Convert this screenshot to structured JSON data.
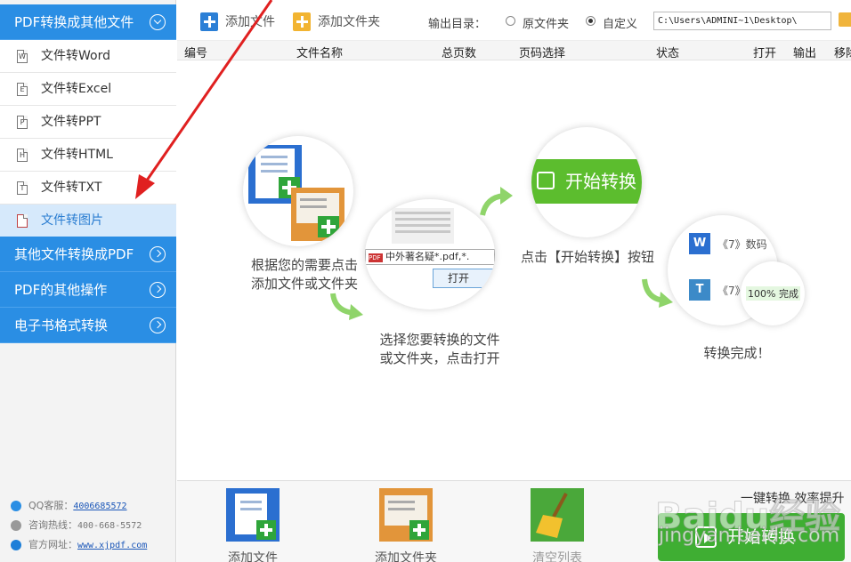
{
  "sidebar": {
    "sections": [
      {
        "label": "PDF转换成其他文件",
        "expanded": true
      },
      {
        "label": "其他文件转换成PDF",
        "expanded": false
      },
      {
        "label": "PDF的其他操作",
        "expanded": false
      },
      {
        "label": "电子书格式转换",
        "expanded": false
      }
    ],
    "items": [
      {
        "label": "文件转Word",
        "icon": "W"
      },
      {
        "label": "文件转Excel",
        "icon": "E"
      },
      {
        "label": "文件转PPT",
        "icon": "P"
      },
      {
        "label": "文件转HTML",
        "icon": "H"
      },
      {
        "label": "文件转TXT",
        "icon": "T"
      },
      {
        "label": "文件转图片",
        "icon": "image",
        "active": true
      }
    ],
    "contact": {
      "qq_label": "QQ客服：",
      "qq_value": "4006685572",
      "phone_label": "咨询热线：",
      "phone_value": "400-668-5572",
      "site_label": "官方网址：",
      "site_value": "www.xjpdf.com"
    }
  },
  "toolbar": {
    "add_file": "添加文件",
    "add_folder": "添加文件夹",
    "output_label": "输出目录：",
    "radio_original": "原文件夹",
    "radio_custom": "自定义",
    "selected_radio": "自定义",
    "output_path": "C:\\Users\\ADMINI~1\\Desktop\\"
  },
  "table_headers": [
    "编号",
    "文件名称",
    "总页数",
    "页码选择",
    "状态",
    "打开",
    "输出",
    "移除"
  ],
  "illustration": {
    "step1_caption": [
      "根据您的需要点击",
      "添加文件或文件夹"
    ],
    "step2_caption": [
      "选择您要转换的文件",
      "或文件夹，点击打开"
    ],
    "step2_filename": "中外著名疑",
    "step2_ext": "*.pdf,*.",
    "step2_open": "打开",
    "step3_button": "开始转换",
    "step3_caption": "点击【开始转换】按钮",
    "step4_item1": "《7》数码",
    "step4_item2": "《7》",
    "step4_progress": "100%",
    "step4_done": "完成",
    "step4_caption": "转换完成！"
  },
  "bottom": {
    "add_file": "添加文件",
    "add_folder": "添加文件夹",
    "clear_list": "清空列表",
    "tagline": "一键转换  效率提升",
    "start": "开始转换"
  },
  "watermark": {
    "line1": "Baidu经验",
    "line2": "jingyan.baidu.com"
  },
  "colors": {
    "accent_blue": "#2a8ee4",
    "green": "#3fae33",
    "active_bg": "#d6e9fb"
  }
}
